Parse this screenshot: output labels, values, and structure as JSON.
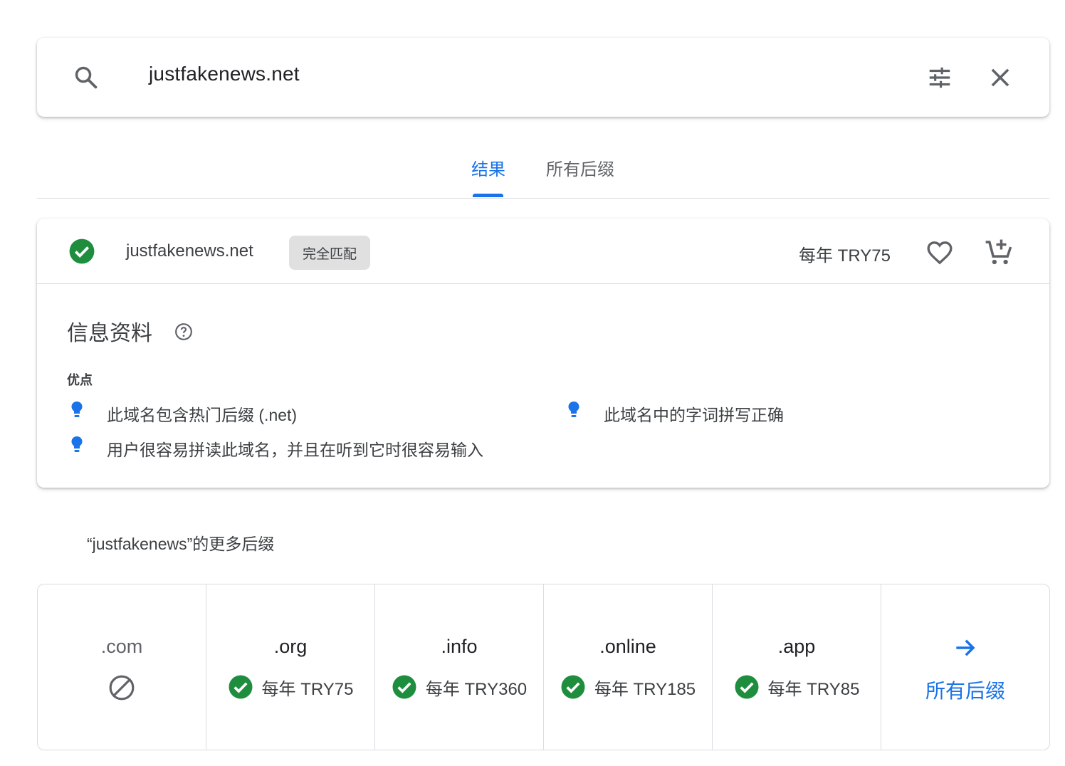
{
  "search": {
    "query": "justfakenews.net"
  },
  "tabs": [
    {
      "label": "结果",
      "active": true
    },
    {
      "label": "所有后缀",
      "active": false
    }
  ],
  "result": {
    "domain_main": "justfakenews",
    "domain_tld": ".net",
    "badge": "完全匹配",
    "price": "每年 TRY75",
    "info_title": "信息资料",
    "pros_label": "优点",
    "pros": [
      "此域名包含热门后缀 (.net)",
      "此域名中的字词拼写正确",
      "用户很容易拼读此域名，并且在听到它时很容易输入"
    ]
  },
  "more": {
    "title": "“justfakenews”的更多后缀",
    "tlds": [
      {
        "name": ".com",
        "status": "unavailable",
        "price": ""
      },
      {
        "name": ".org",
        "status": "available",
        "price": "每年 TRY75"
      },
      {
        "name": ".info",
        "status": "available",
        "price": "每年 TRY360"
      },
      {
        "name": ".online",
        "status": "available",
        "price": "每年 TRY185"
      },
      {
        "name": ".app",
        "status": "available",
        "price": "每年 TRY85"
      }
    ],
    "all_label": "所有后缀"
  },
  "colors": {
    "accent": "#1a73e8",
    "available": "#1e8e3e",
    "border": "#dadce0"
  },
  "icons": [
    "search-icon",
    "tune-icon",
    "close-icon",
    "check-circle-icon",
    "heart-icon",
    "add-cart-icon",
    "help-icon",
    "lightbulb-icon",
    "block-icon",
    "arrow-right-icon"
  ]
}
